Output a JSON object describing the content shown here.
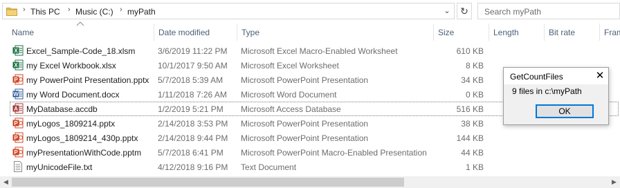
{
  "address_bar": {
    "crumbs": [
      "This PC",
      "Music (C:)",
      "myPath"
    ],
    "search_placeholder": "Search myPath",
    "icons": {
      "folder": "folder-icon",
      "dropdown": "chevron-down-icon",
      "refresh": "refresh-icon"
    }
  },
  "columns": {
    "name": "Name",
    "date": "Date modified",
    "type": "Type",
    "size": "Size",
    "length": "Length",
    "bitrate": "Bit rate",
    "frame": "Fram"
  },
  "files": [
    {
      "name": "Excel_Sample-Code_18.xlsm",
      "date": "3/6/2019 11:22 PM",
      "type": "Microsoft Excel Macro-Enabled Worksheet",
      "size": "610 KB",
      "icon": "excel-icon"
    },
    {
      "name": "my Excel Workbook.xlsx",
      "date": "10/1/2017 9:50 AM",
      "type": "Microsoft Excel Worksheet",
      "size": "8 KB",
      "icon": "excel-icon"
    },
    {
      "name": "my PowerPoint Presentation.pptx",
      "date": "5/7/2018 5:39 AM",
      "type": "Microsoft PowerPoint Presentation",
      "size": "34 KB",
      "icon": "powerpoint-icon"
    },
    {
      "name": "my Word Document.docx",
      "date": "1/11/2018 7:26 AM",
      "type": "Microsoft Word Document",
      "size": "0 KB",
      "icon": "word-icon"
    },
    {
      "name": "MyDatabase.accdb",
      "date": "1/2/2019 5:21 PM",
      "type": "Microsoft Access Database",
      "size": "516 KB",
      "icon": "access-icon"
    },
    {
      "name": "myLogos_1809214.pptx",
      "date": "2/14/2018 3:53 PM",
      "type": "Microsoft PowerPoint Presentation",
      "size": "38 KB",
      "icon": "powerpoint-icon"
    },
    {
      "name": "myLogos_1809214_430p.pptx",
      "date": "2/14/2018 9:44 PM",
      "type": "Microsoft PowerPoint Presentation",
      "size": "144 KB",
      "icon": "powerpoint-icon"
    },
    {
      "name": "myPresentationWithCode.pptm",
      "date": "5/7/2018 6:41 PM",
      "type": "Microsoft PowerPoint Macro-Enabled Presentation",
      "size": "44 KB",
      "icon": "powerpoint-icon"
    },
    {
      "name": "myUnicodeFile.txt",
      "date": "4/12/2018 9:16 PM",
      "type": "Text Document",
      "size": "1 KB",
      "icon": "text-file-icon"
    }
  ],
  "selected_index": 4,
  "dialog": {
    "title": "GetCountFiles",
    "message": "9 files in c:\\myPath",
    "ok_label": "OK"
  },
  "colors": {
    "excel": "#1e7145",
    "word": "#2b579a",
    "powerpoint": "#d24726",
    "access": "#a4373a",
    "header_text": "#4c607a"
  }
}
